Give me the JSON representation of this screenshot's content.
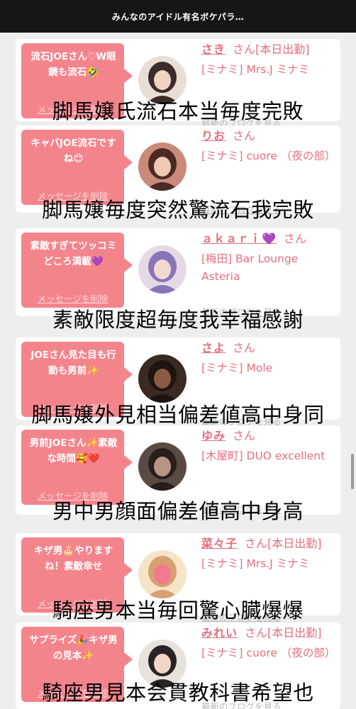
{
  "header": {
    "title": "みんなのアイドル有名ボケパラ…"
  },
  "colors": {
    "accent": "#e46f7d",
    "bubble": "#f4848c",
    "header_bg": "#161616"
  },
  "cards": [
    {
      "message": "流石JOEさん♡W眼鏡も流石🤣",
      "delete_label": "メッセージを削除",
      "name": "さき",
      "suffix": "さん[本日出勤]",
      "shop": "[ミナミ] Mrs.J ミナミ",
      "blog_link": "最新のブログを見る",
      "avatar_icon": "woman-photo-icon",
      "caption": "脚馬嬢氏流石本当毎度完敗"
    },
    {
      "message": "キャバJOE流石ですね😊",
      "delete_label": "メッセージを削除",
      "name": "りお",
      "suffix": "さん",
      "shop": "[ミナミ] cuore （夜の部）",
      "blog_link": "最新のブログを見る",
      "avatar_icon": "woman-photo-icon",
      "caption": "脚馬嬢毎度突然驚流石我完敗"
    },
    {
      "message": "素敵すぎてツッコミどころ満載💜",
      "delete_label": "メッセージを削除",
      "name": "ａｋａｒｉ💜",
      "suffix": "さん",
      "shop": "[梅田] Bar Lounge Asteria",
      "blog_link": "最新のブログを見る",
      "avatar_icon": "woman-photo-icon",
      "caption": "素敵限度超毎度我幸福感謝"
    },
    {
      "message": "JOEさん見た目も行動も男前✨",
      "delete_label": "メッセージを削除",
      "name": "さよ",
      "suffix": "さん",
      "shop": "[ミナミ] Mole",
      "blog_link": "最新のブログを見る",
      "avatar_icon": "woman-photo-icon",
      "caption": "脚馬嬢外見相当偏差値高中身同"
    },
    {
      "message": "男前JOEさん✨素敵な時間🥰❤️",
      "delete_label": "メッセージを削除",
      "name": "ゆみ",
      "suffix": "さん",
      "shop": "[木屋町] DUO excellent",
      "blog_link": "最新のブログを見る",
      "avatar_icon": "woman-photo-icon",
      "caption": "男中男顔面偏差値高中身高"
    },
    {
      "message": "キザ男🎂やりますね！素敵幸せ",
      "delete_label": "メッセージを削除",
      "name": "菜々子",
      "suffix": "さん[本日出勤]",
      "shop": "[ミナミ] Mrs.J ミナミ",
      "blog_link": "最新のブログを見る",
      "avatar_icon": "woman-photo-icon",
      "caption": "騎座男本当毎回驚心臓爆爆"
    },
    {
      "message": "サプライズ🎉キザ男の見本✨",
      "delete_label": "メッセージを削除",
      "name": "みれい",
      "suffix": "さん[本日出勤]",
      "shop": "[ミナミ] cuore （夜の部）",
      "blog_link": "最新のブログを見る",
      "avatar_icon": "woman-photo-icon",
      "caption": "騎座男見本会貫教科書希望也"
    }
  ]
}
